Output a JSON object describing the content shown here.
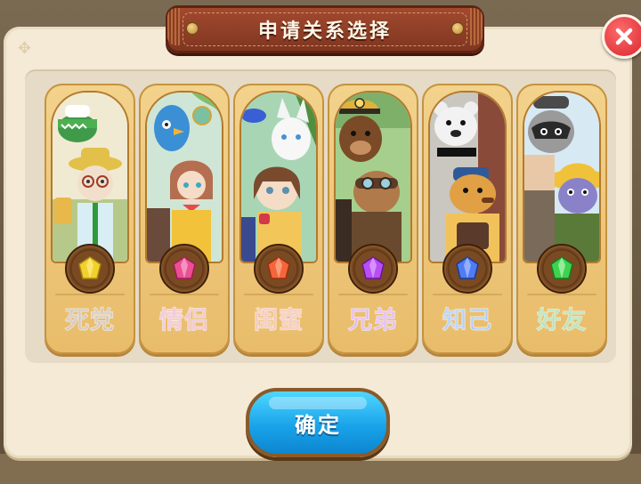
{
  "dialog": {
    "title": "申请关系选择",
    "confirm_label": "确定",
    "close_icon": "close-icon"
  },
  "relations": [
    {
      "label": "死党",
      "label_color": "#8a6a4a",
      "gem_color": "#e7c22a",
      "bg": "#f1ead2"
    },
    {
      "label": "情侣",
      "label_color": "#d65c7c",
      "gem_color": "#e84d8c",
      "bg": "#cfe6d6"
    },
    {
      "label": "闺蜜",
      "label_color": "#e0664a",
      "gem_color": "#f36c3c",
      "bg": "#a8d6b5"
    },
    {
      "label": "兄弟",
      "label_color": "#b24fd2",
      "gem_color": "#b94dff",
      "bg": "#a6cf8e"
    },
    {
      "label": "知己",
      "label_color": "#3f7fe0",
      "gem_color": "#4f7cf2",
      "bg": "#c9c7c0"
    },
    {
      "label": "好友",
      "label_color": "#3fae3f",
      "gem_color": "#3fd24f",
      "bg": "#d7e9f3"
    }
  ]
}
